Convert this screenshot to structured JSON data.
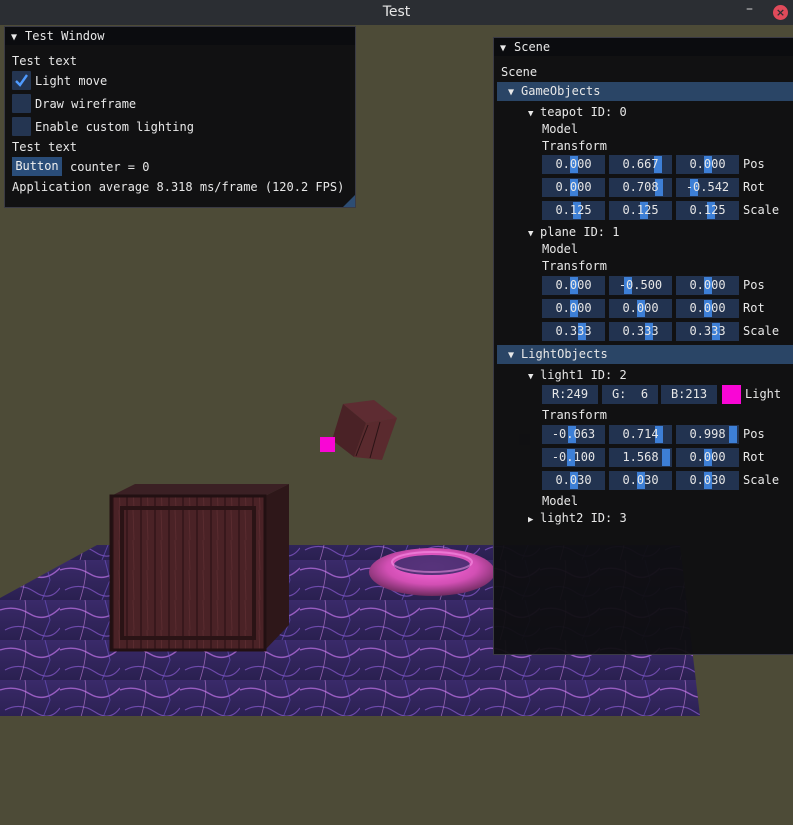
{
  "window": {
    "title": "Test"
  },
  "colors": {
    "light1": "#f906d5",
    "accent": "#3d7fd6",
    "frame_bg": "#223350",
    "header_bg": "#2a4566",
    "background": "#4d4b37"
  },
  "icons": [
    "minimize-icon",
    "close-icon",
    "collapse-arrow-icon",
    "checkmark-icon",
    "expand-arrow-icon"
  ],
  "test_window": {
    "title": "Test Window",
    "text1": "Test text",
    "checkboxes": [
      {
        "label": "Light move",
        "checked": true
      },
      {
        "label": "Draw wireframe",
        "checked": false
      },
      {
        "label": "Enable custom lighting",
        "checked": false
      }
    ],
    "text2": "Test text",
    "button_label": "Button",
    "counter_text": "counter = 0",
    "stats": "Application average 8.318 ms/frame (120.2 FPS)"
  },
  "scene_window": {
    "title": "Scene",
    "label": "Scene",
    "game_objects": {
      "header": "GameObjects",
      "items": [
        {
          "label": "teapot ID: 0",
          "model": "Model",
          "transform": "Transform",
          "rows": [
            {
              "label": "Pos",
              "values": [
                "0.000",
                "0.667",
                "0.000"
              ],
              "grab": [
                0.0,
                0.667,
                0.0
              ]
            },
            {
              "label": "Rot",
              "values": [
                "0.000",
                "0.708",
                "-0.542"
              ],
              "grab": [
                0.0,
                0.708,
                -0.542
              ]
            },
            {
              "label": "Scale",
              "values": [
                "0.125",
                "0.125",
                "0.125"
              ],
              "grab": [
                0.125,
                0.125,
                0.125
              ]
            }
          ]
        },
        {
          "label": "plane ID: 1",
          "model": "Model",
          "transform": "Transform",
          "rows": [
            {
              "label": "Pos",
              "values": [
                "0.000",
                "-0.500",
                "0.000"
              ],
              "grab": [
                0.0,
                -0.5,
                0.0
              ]
            },
            {
              "label": "Rot",
              "values": [
                "0.000",
                "0.000",
                "0.000"
              ],
              "grab": [
                0.0,
                0.0,
                0.0
              ]
            },
            {
              "label": "Scale",
              "values": [
                "0.333",
                "0.333",
                "0.333"
              ],
              "grab": [
                0.333,
                0.333,
                0.333
              ]
            }
          ]
        }
      ]
    },
    "light_objects": {
      "header": "LightObjects",
      "light1": {
        "label": "light1 ID: 2",
        "r": "R:249",
        "g": "G:  6",
        "b": "B:213",
        "color_label": "Light",
        "transform": "Transform",
        "rows": [
          {
            "label": "Pos",
            "values": [
              "-0.063",
              "0.714",
              "0.998"
            ],
            "grab": [
              -0.063,
              0.714,
              0.998
            ]
          },
          {
            "label": "Rot",
            "values": [
              "-0.100",
              "1.568",
              "0.000"
            ],
            "grab": [
              -0.1,
              1.568,
              0.0
            ]
          },
          {
            "label": "Scale",
            "values": [
              "0.030",
              "0.030",
              "0.030"
            ],
            "grab": [
              0.03,
              0.03,
              0.03
            ]
          }
        ],
        "model": "Model"
      },
      "light2": {
        "label": "light2 ID: 3"
      }
    }
  }
}
